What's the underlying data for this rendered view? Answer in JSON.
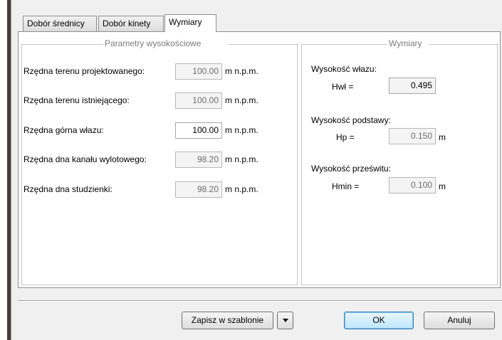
{
  "tabs": [
    {
      "label": "Dobór średnicy",
      "active": false
    },
    {
      "label": "Dobór kinety",
      "active": false
    },
    {
      "label": "Wymiary",
      "active": true
    }
  ],
  "height_params": {
    "title": "Parametry wysokościowe",
    "rows": [
      {
        "label": "Rzędna terenu projektowanego:",
        "value": "100.00",
        "unit": "m n.p.m.",
        "editable": false
      },
      {
        "label": "Rzędna terenu istniejącego:",
        "value": "100.00",
        "unit": "m n.p.m.",
        "editable": false
      },
      {
        "label": "Rzędna górna włazu:",
        "value": "100.00",
        "unit": "m n.p.m.",
        "editable": true
      },
      {
        "label": "Rzędna dna kanału wylotowego:",
        "value": "98.20",
        "unit": "m n.p.m.",
        "editable": false
      },
      {
        "label": "Rzędna dna studzienki:",
        "value": "98.20",
        "unit": "m n.p.m.",
        "editable": false
      }
    ]
  },
  "dimensions": {
    "title": "Wymiary",
    "items": [
      {
        "heading": "Wysokość włazu:",
        "symbol": "Hwł =",
        "value": "0.495",
        "unit": ""
      },
      {
        "heading": "Wysokość podstawy:",
        "symbol": "Hp =",
        "value": "0.150",
        "unit": "m"
      },
      {
        "heading": "Wysokość prześwitu:",
        "symbol": "Hmin =",
        "value": "0.100",
        "unit": "m"
      }
    ]
  },
  "buttons": {
    "save_template": "Zapisz w szablonie",
    "ok": "OK",
    "cancel": "Anuluj"
  }
}
